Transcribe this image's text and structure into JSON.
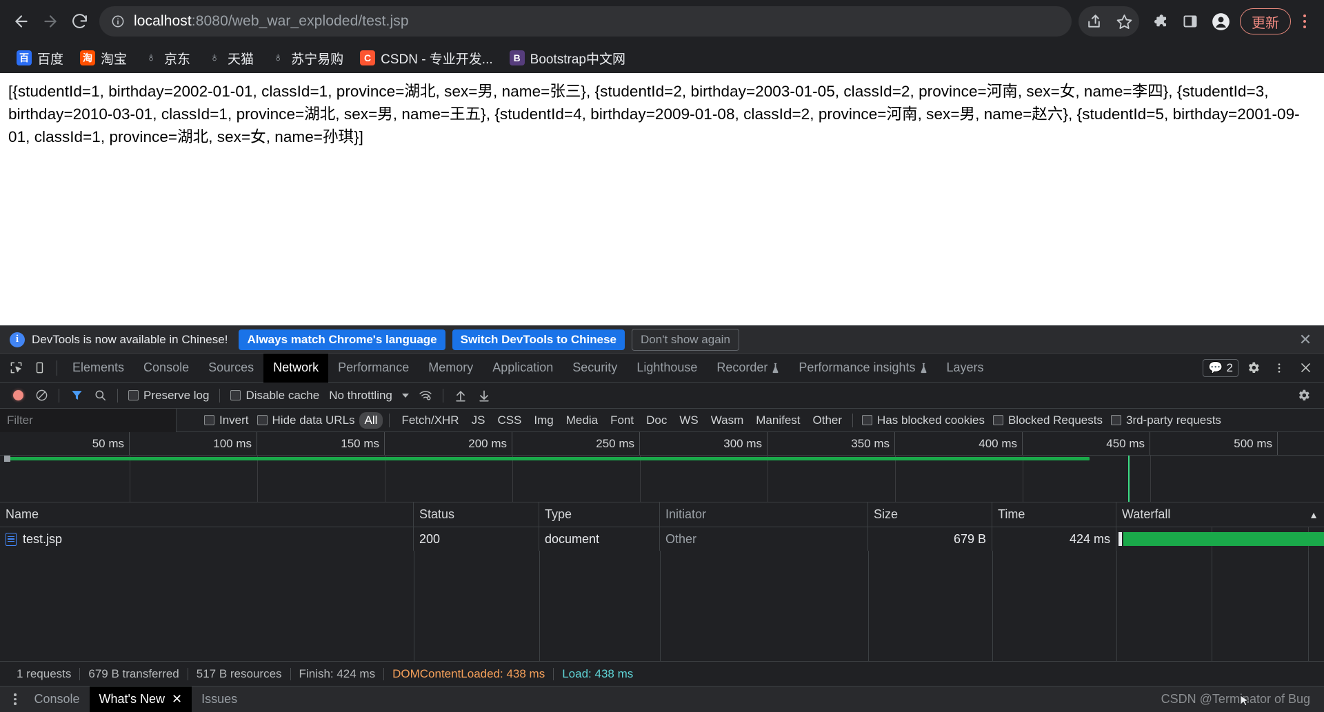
{
  "browser": {
    "nav": {
      "back_title": "Back",
      "forward_title": "Forward",
      "reload_title": "Reload"
    },
    "omnibox": {
      "host": "localhost",
      "path": ":8080/web_war_exploded/test.jsp",
      "full_url": "localhost:8080/web_war_exploded/test.jsp",
      "site_info_title": "View site information"
    },
    "actions": {
      "share_title": "Share this page",
      "bookmark_title": "Bookmark this tab",
      "extensions_title": "Extensions",
      "sidepanel_title": "Side panel",
      "profile_title": "Profile",
      "update_label": "更新",
      "menu_title": "Customize and control Google Chrome"
    },
    "bookmarks": [
      {
        "label": "百度",
        "glyph": "百",
        "bg": "#2b6ef5"
      },
      {
        "label": "淘宝",
        "glyph": "淘",
        "bg": "#ff5000"
      },
      {
        "label": "京东",
        "glyph": "♁",
        "bg": "#6b6f74"
      },
      {
        "label": "天猫",
        "glyph": "♁",
        "bg": "#6b6f74"
      },
      {
        "label": "苏宁易购",
        "glyph": "♁",
        "bg": "#6b6f74"
      },
      {
        "label": "CSDN - 专业开发...",
        "glyph": "C",
        "bg": "#fc5531"
      },
      {
        "label": "Bootstrap中文网",
        "glyph": "B",
        "bg": "#563d7c"
      }
    ]
  },
  "page": {
    "body_text": "[{studentId=1, birthday=2002-01-01, classId=1, province=湖北, sex=男, name=张三}, {studentId=2, birthday=2003-01-05, classId=2, province=河南, sex=女, name=李四}, {studentId=3, birthday=2010-03-01, classId=1, province=湖北, sex=男, name=王五}, {studentId=4, birthday=2009-01-08, classId=2, province=河南, sex=男, name=赵六}, {studentId=5, birthday=2001-09-01, classId=1, province=湖北, sex=女, name=孙琪}]",
    "records": [
      {
        "studentId": "1",
        "birthday": "2002-01-01",
        "classId": "1",
        "province": "湖北",
        "sex": "男",
        "name": "张三"
      },
      {
        "studentId": "2",
        "birthday": "2003-01-05",
        "classId": "2",
        "province": "河南",
        "sex": "女",
        "name": "李四"
      },
      {
        "studentId": "3",
        "birthday": "2010-03-01",
        "classId": "1",
        "province": "湖北",
        "sex": "男",
        "name": "王五"
      },
      {
        "studentId": "4",
        "birthday": "2009-01-08",
        "classId": "2",
        "province": "河南",
        "sex": "男",
        "name": "赵六"
      },
      {
        "studentId": "5",
        "birthday": "2001-09-01",
        "classId": "1",
        "province": "湖北",
        "sex": "女",
        "name": "孙琪"
      }
    ]
  },
  "devtools": {
    "notice": {
      "text": "DevTools is now available in Chinese!",
      "btn_always": "Always match Chrome's language",
      "btn_switch": "Switch DevTools to Chinese",
      "btn_dismiss": "Don't show again",
      "close_label": "✕"
    },
    "tabs": [
      {
        "label": "Elements",
        "active": false,
        "beaker": false
      },
      {
        "label": "Console",
        "active": false,
        "beaker": false
      },
      {
        "label": "Sources",
        "active": false,
        "beaker": false
      },
      {
        "label": "Network",
        "active": true,
        "beaker": false
      },
      {
        "label": "Performance",
        "active": false,
        "beaker": false
      },
      {
        "label": "Memory",
        "active": false,
        "beaker": false
      },
      {
        "label": "Application",
        "active": false,
        "beaker": false
      },
      {
        "label": "Security",
        "active": false,
        "beaker": false
      },
      {
        "label": "Lighthouse",
        "active": false,
        "beaker": false
      },
      {
        "label": "Recorder",
        "active": false,
        "beaker": true
      },
      {
        "label": "Performance insights",
        "active": false,
        "beaker": true
      },
      {
        "label": "Layers",
        "active": false,
        "beaker": false
      }
    ],
    "tabs_right": {
      "message_count": "2",
      "settings_title": "Settings",
      "more_title": "More options",
      "close_title": "Close DevTools"
    },
    "network_toolbar": {
      "record_title": "Stop recording network log",
      "clear_title": "Clear",
      "filter_title": "Filter",
      "search_title": "Search",
      "preserve_log": "Preserve log",
      "disable_cache": "Disable cache",
      "throttling": "No throttling",
      "wifi_title": "Network conditions",
      "import_title": "Import HAR file",
      "export_title": "Export HAR file",
      "settings_title": "Network settings"
    },
    "filter_row": {
      "placeholder": "Filter",
      "value": "",
      "invert": "Invert",
      "hide_data_urls": "Hide data URLs",
      "types": [
        "All",
        "Fetch/XHR",
        "JS",
        "CSS",
        "Img",
        "Media",
        "Font",
        "Doc",
        "WS",
        "Wasm",
        "Manifest",
        "Other"
      ],
      "active_type": "All",
      "has_blocked_cookies": "Has blocked cookies",
      "blocked_requests": "Blocked Requests",
      "third_party": "3rd-party requests"
    },
    "overview": {
      "ticks": [
        "50 ms",
        "100 ms",
        "150 ms",
        "200 ms",
        "250 ms",
        "300 ms",
        "350 ms",
        "400 ms",
        "450 ms",
        "500 ms"
      ]
    },
    "table": {
      "columns": [
        "Name",
        "Status",
        "Type",
        "Initiator",
        "Size",
        "Time",
        "Waterfall"
      ],
      "rows": [
        {
          "name": "test.jsp",
          "status": "200",
          "type": "document",
          "initiator": "Other",
          "size": "679 B",
          "time": "424 ms"
        }
      ]
    },
    "summary": {
      "requests": "1 requests",
      "transferred": "679 B transferred",
      "resources": "517 B resources",
      "finish": "Finish: 424 ms",
      "dom_content_loaded": "DOMContentLoaded: 438 ms",
      "load": "Load: 438 ms"
    },
    "drawer": {
      "tabs": [
        {
          "label": "Console",
          "active": false,
          "closable": false
        },
        {
          "label": "What's New",
          "active": true,
          "closable": true
        },
        {
          "label": "Issues",
          "active": false,
          "closable": false
        }
      ],
      "close_glyph": "✕",
      "watermark": "CSDN @Terminator of Bug"
    },
    "colors": {
      "accent_blue": "#1a73e8",
      "waterfall_green": "#1aa94a",
      "dcl_orange": "#f5a05a",
      "load_teal": "#5fd4d6",
      "active_tab_bg": "#000000"
    }
  }
}
